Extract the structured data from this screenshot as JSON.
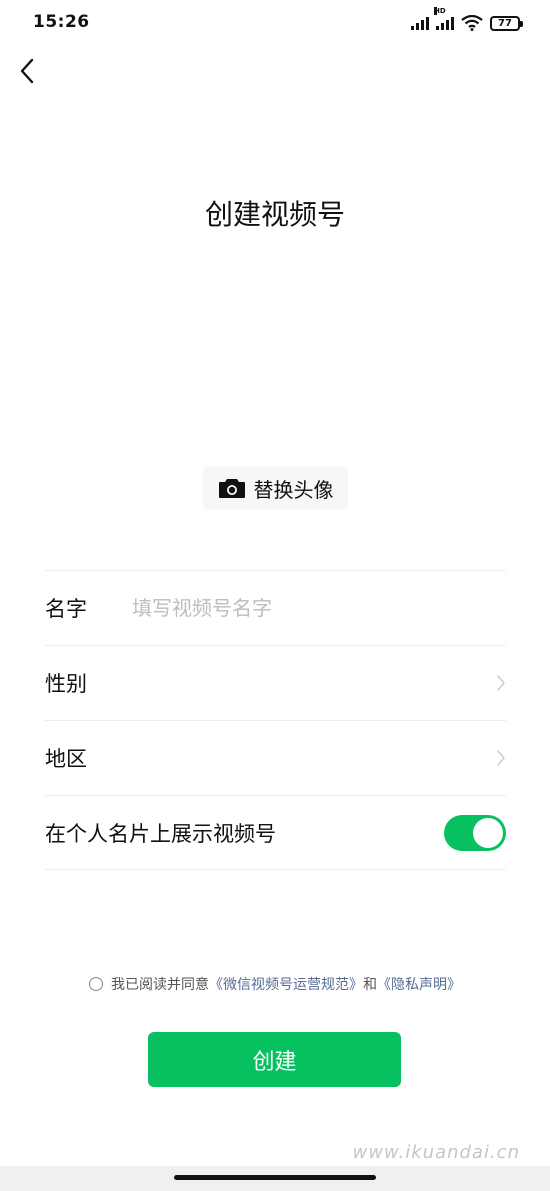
{
  "status_bar": {
    "time": "15:26",
    "hd_label": "HD",
    "battery_level": "77"
  },
  "page": {
    "title": "创建视频号"
  },
  "avatar": {
    "button_label": "替换头像",
    "icon": "camera-icon"
  },
  "form": {
    "name": {
      "label": "名字",
      "placeholder": "填写视频号名字",
      "value": ""
    },
    "gender": {
      "label": "性别",
      "value": ""
    },
    "region": {
      "label": "地区",
      "value": ""
    },
    "show_on_card": {
      "label": "在个人名片上展示视频号",
      "enabled": true
    }
  },
  "agreement": {
    "prefix": "我已阅读并同意",
    "link1": "《微信视频号运营规范》",
    "connector": "和",
    "link2": "《隐私声明》",
    "checked": false
  },
  "actions": {
    "create_label": "创建"
  },
  "watermark": "www.ikuandai.cn",
  "colors": {
    "accent_green": "#07c160",
    "link_blue": "#576b95",
    "placeholder_gray": "#bdbdbd"
  }
}
